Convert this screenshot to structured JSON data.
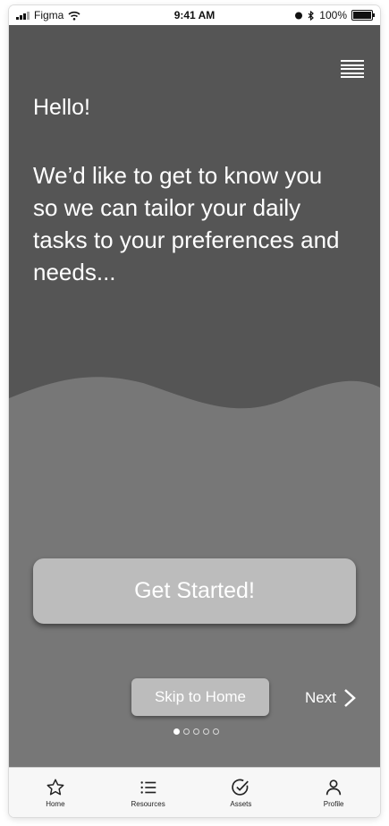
{
  "status_bar": {
    "carrier": "Figma",
    "time": "9:41 AM",
    "battery": "100%"
  },
  "onboarding": {
    "greeting": "Hello!",
    "intro": "We’d like to get to know you so we can tailor your daily tasks to your preferences and needs...",
    "get_started_label": "Get Started!",
    "skip_label": "Skip to Home",
    "next_label": "Next",
    "page_count": 5,
    "active_page": 1
  },
  "tab_bar": [
    {
      "label": "Home",
      "icon": "star-icon"
    },
    {
      "label": "Resources",
      "icon": "list-icon"
    },
    {
      "label": "Assets",
      "icon": "check-circle-icon"
    },
    {
      "label": "Profile",
      "icon": "person-icon"
    }
  ],
  "colors": {
    "background_dark": "#555555",
    "wave": "#777777",
    "button": "#bcbcbc",
    "text": "#ffffff"
  }
}
